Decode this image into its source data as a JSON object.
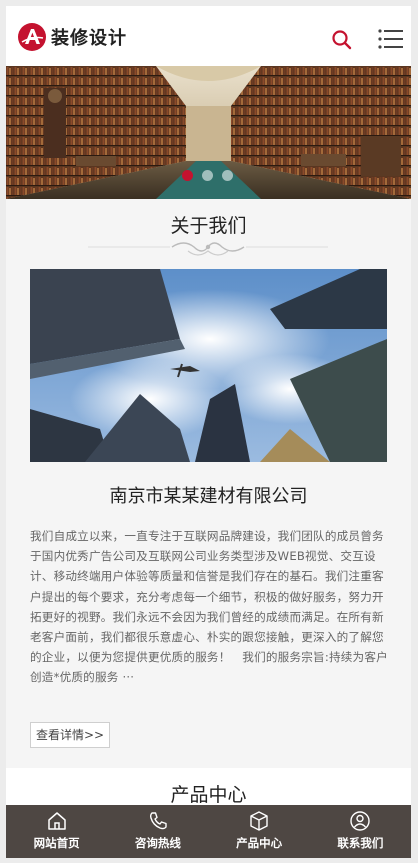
{
  "header": {
    "brand": "装修设计",
    "logo_icon": "brand-a-logo",
    "search_icon": "search-icon",
    "menu_icon": "hamburger-menu-icon",
    "accent_color": "#c4122f"
  },
  "banner": {
    "slides_total": 3,
    "active_slide": 1
  },
  "about": {
    "title": "关于我们",
    "company": "南京市某某建材有限公司",
    "text": "我们自成立以来，一直专注于互联网品牌建设，我们团队的成员曾务于国内优秀广告公司及互联网公司业务类型涉及WEB视觉、交互设计、移动终端用户体验等质量和信誉是我们存在的基石。我们注重客户提出的每个要求，充分考虑每一个细节，积极的做好服务，努力开拓更好的视野。我们永远不会因为我们曾经的成绩而满足。在所有新老客户面前，我们都很乐意虚心、朴实的跟您接触，更深入的了解您的企业，以便为您提供更优质的服务！　我们的服务宗旨:持续为客户创造*优质的服务 ···",
    "more_label": "查看详情>>"
  },
  "products": {
    "title": "产品中心"
  },
  "bottom_nav": {
    "background": "#4e4743",
    "items": [
      {
        "label": "网站首页",
        "icon": "home-icon"
      },
      {
        "label": "咨询热线",
        "icon": "phone-icon"
      },
      {
        "label": "产品中心",
        "icon": "cube-icon"
      },
      {
        "label": "联系我们",
        "icon": "user-icon"
      }
    ]
  }
}
